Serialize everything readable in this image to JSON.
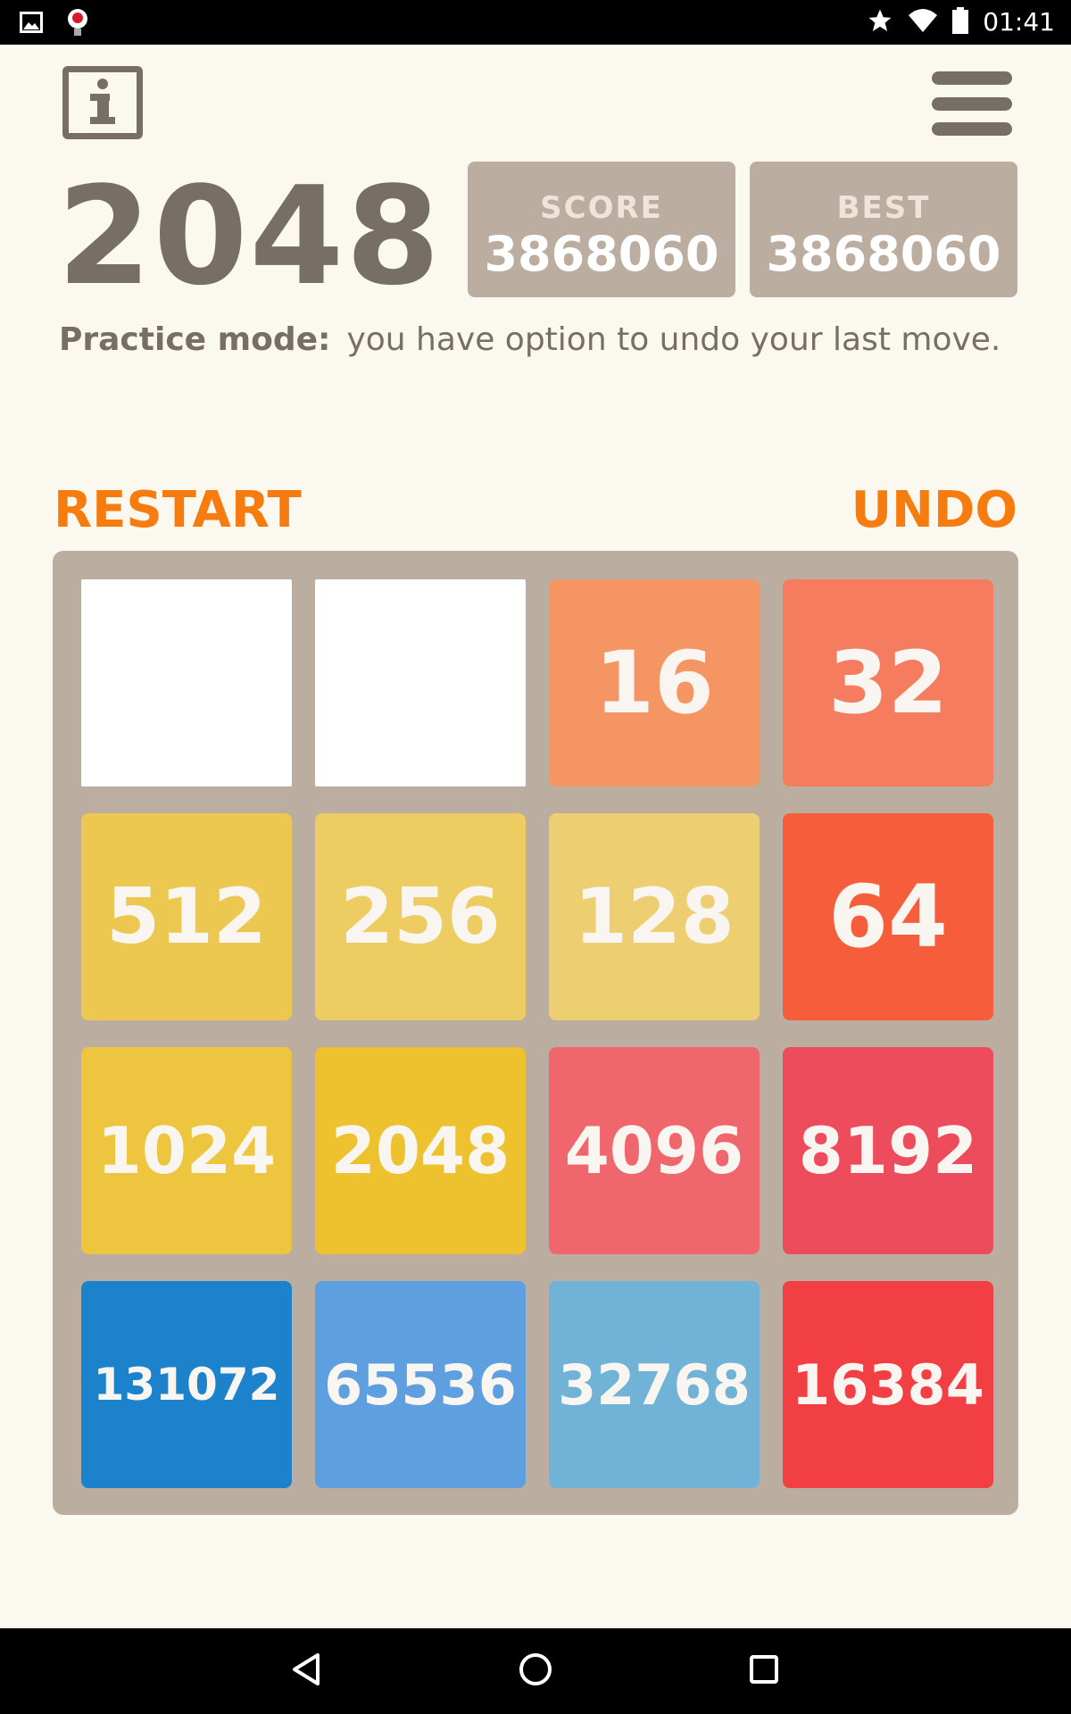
{
  "status_bar": {
    "time": "01:41",
    "icons": [
      "gallery-icon",
      "notification-app-icon",
      "star-icon",
      "wifi-icon",
      "battery-icon"
    ]
  },
  "header": {
    "title": "2048",
    "score_label": "SCORE",
    "score_value": "3868060",
    "best_label": "BEST",
    "best_value": "3868060",
    "practice_label": "Practice mode:",
    "practice_text": "you have option to undo your last move."
  },
  "actions": {
    "restart_label": "RESTART",
    "undo_label": "UNDO"
  },
  "colors": {
    "background": "#faf8ef",
    "board": "#bbada0",
    "title_text": "#776e65",
    "action_text": "#f67c0f",
    "tile_text": "#f9f6f2"
  },
  "board": {
    "rows": [
      [
        {
          "value": "",
          "color": "#ffffff"
        },
        {
          "value": "",
          "color": "#ffffff"
        },
        {
          "value": "16",
          "color": "#f59563"
        },
        {
          "value": "32",
          "color": "#f67c5f"
        }
      ],
      [
        {
          "value": "512",
          "color": "#edc850"
        },
        {
          "value": "256",
          "color": "#edcc61"
        },
        {
          "value": "128",
          "color": "#edcf72"
        },
        {
          "value": "64",
          "color": "#f65e3b"
        }
      ],
      [
        {
          "value": "1024",
          "color": "#edc53f"
        },
        {
          "value": "2048",
          "color": "#edc22e"
        },
        {
          "value": "4096",
          "color": "#ef666d"
        },
        {
          "value": "8192",
          "color": "#ed4c5c"
        }
      ],
      [
        {
          "value": "131072",
          "color": "#1c82cc"
        },
        {
          "value": "65536",
          "color": "#5e9fe0"
        },
        {
          "value": "32768",
          "color": "#71b3d6"
        },
        {
          "value": "16384",
          "color": "#f23f44"
        }
      ]
    ]
  },
  "nav_bar": {
    "buttons": [
      "back-icon",
      "home-icon",
      "recents-icon"
    ]
  }
}
